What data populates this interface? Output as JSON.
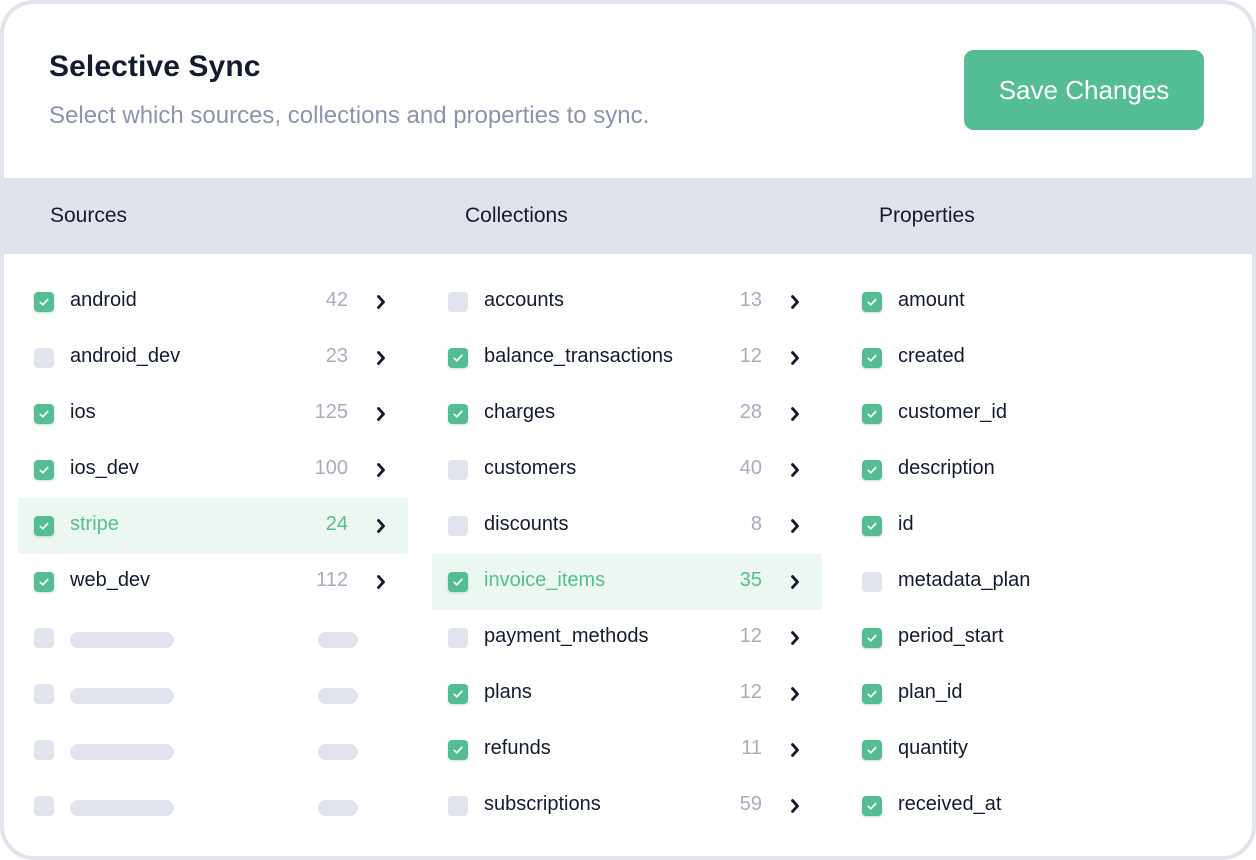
{
  "header": {
    "title": "Selective Sync",
    "subtitle": "Select which sources, collections and properties to sync.",
    "save_label": "Save Changes"
  },
  "colors": {
    "accent": "#55bd94",
    "active_row_bg": "#edf7f2",
    "header_band": "#e0e3eb",
    "muted_text": "#8a94ab"
  },
  "columns": {
    "sources": "Sources",
    "collections": "Collections",
    "properties": "Properties"
  },
  "sources": [
    {
      "label": "android",
      "count": "42",
      "checked": true,
      "active": false
    },
    {
      "label": "android_dev",
      "count": "23",
      "checked": false,
      "active": false
    },
    {
      "label": "ios",
      "count": "125",
      "checked": true,
      "active": false
    },
    {
      "label": "ios_dev",
      "count": "100",
      "checked": true,
      "active": false
    },
    {
      "label": "stripe",
      "count": "24",
      "checked": true,
      "active": true
    },
    {
      "label": "web_dev",
      "count": "112",
      "checked": true,
      "active": false
    }
  ],
  "source_placeholders": 4,
  "collections": [
    {
      "label": "accounts",
      "count": "13",
      "checked": false,
      "active": false
    },
    {
      "label": "balance_transactions",
      "count": "12",
      "checked": true,
      "active": false
    },
    {
      "label": "charges",
      "count": "28",
      "checked": true,
      "active": false
    },
    {
      "label": "customers",
      "count": "40",
      "checked": false,
      "active": false
    },
    {
      "label": "discounts",
      "count": "8",
      "checked": false,
      "active": false
    },
    {
      "label": "invoice_items",
      "count": "35",
      "checked": true,
      "active": true
    },
    {
      "label": "payment_methods",
      "count": "12",
      "checked": false,
      "active": false
    },
    {
      "label": "plans",
      "count": "12",
      "checked": true,
      "active": false
    },
    {
      "label": "refunds",
      "count": "11",
      "checked": true,
      "active": false
    },
    {
      "label": "subscriptions",
      "count": "59",
      "checked": false,
      "active": false
    }
  ],
  "properties": [
    {
      "label": "amount",
      "checked": true
    },
    {
      "label": "created",
      "checked": true
    },
    {
      "label": "customer_id",
      "checked": true
    },
    {
      "label": "description",
      "checked": true
    },
    {
      "label": "id",
      "checked": true
    },
    {
      "label": "metadata_plan",
      "checked": false
    },
    {
      "label": "period_start",
      "checked": true
    },
    {
      "label": "plan_id",
      "checked": true
    },
    {
      "label": "quantity",
      "checked": true
    },
    {
      "label": "received_at",
      "checked": true
    }
  ]
}
